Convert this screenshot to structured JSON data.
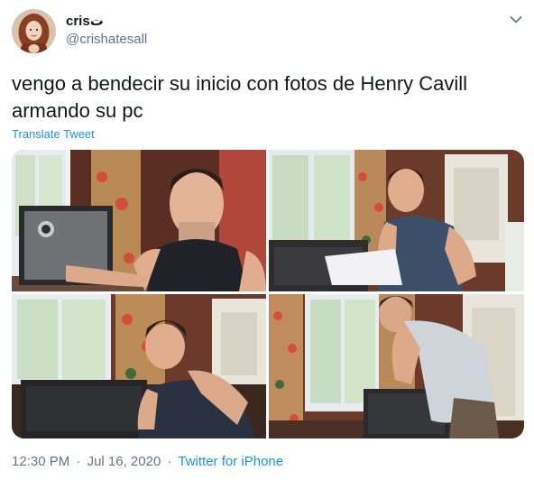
{
  "user": {
    "display_name": "cris",
    "display_name_emoji": "ت",
    "handle": "@crishatesall"
  },
  "tweet": {
    "text": "vengo a bendecir su inicio con fotos de Henry Cavill armando su pc",
    "translate_label": "Translate Tweet"
  },
  "meta": {
    "time": "12:30 PM",
    "separator": "·",
    "date": "Jul 16, 2020",
    "source": "Twitter for iPhone"
  },
  "icons": {
    "more": "chevron-down-icon"
  },
  "colors": {
    "link": "#1b95e0",
    "secondary_text": "#657786",
    "primary_text": "#14171a"
  }
}
